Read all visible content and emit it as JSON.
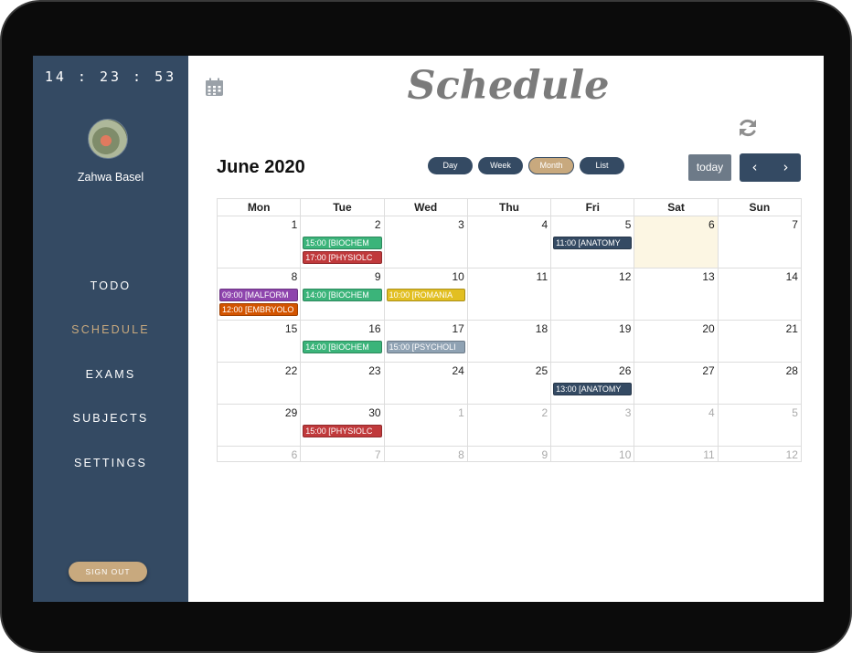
{
  "sidebar": {
    "clock": "14 : 23 : 53",
    "user_name": "Zahwa Basel",
    "nav": [
      {
        "label": "TODO",
        "active": false
      },
      {
        "label": "SCHEDULE",
        "active": true
      },
      {
        "label": "EXAMS",
        "active": false
      },
      {
        "label": "SUBJECTS",
        "active": false
      },
      {
        "label": "SETTINGS",
        "active": false
      }
    ],
    "sign_out_label": "SIGN OUT"
  },
  "header": {
    "title": "Schedule",
    "calendar_icon": "calendar-icon",
    "refresh_icon": "refresh-icon"
  },
  "toolbar": {
    "month_title": "June 2020",
    "views": [
      {
        "label": "Day",
        "active": false
      },
      {
        "label": "Week",
        "active": false
      },
      {
        "label": "Month",
        "active": true
      },
      {
        "label": "List",
        "active": false
      }
    ],
    "today_label": "today",
    "prev_label": "‹",
    "next_label": "›"
  },
  "calendar": {
    "weekdays": [
      "Mon",
      "Tue",
      "Wed",
      "Thu",
      "Fri",
      "Sat",
      "Sun"
    ],
    "weeks": [
      [
        {
          "day": "1"
        },
        {
          "day": "2",
          "events": [
            {
              "label": "15:00 [BIOCHEM",
              "color": "#3bb47a"
            },
            {
              "label": "17:00 [PHYSIOLC",
              "color": "#c0393b"
            }
          ]
        },
        {
          "day": "3"
        },
        {
          "day": "4"
        },
        {
          "day": "5",
          "events": [
            {
              "label": "11:00 [ANATOMY",
              "color": "#344a63"
            }
          ]
        },
        {
          "day": "6",
          "today": true
        },
        {
          "day": "7"
        }
      ],
      [
        {
          "day": "8",
          "events": [
            {
              "label": "09:00 [MALFORM",
              "color": "#8e44ad"
            },
            {
              "label": "12:00 [EMBRYOLO",
              "color": "#d35400"
            }
          ]
        },
        {
          "day": "9",
          "events": [
            {
              "label": "14:00 [BIOCHEM",
              "color": "#3bb47a"
            }
          ]
        },
        {
          "day": "10",
          "events": [
            {
              "label": "10:00 [ROMANIA",
              "color": "#e2bf22"
            }
          ]
        },
        {
          "day": "11"
        },
        {
          "day": "12"
        },
        {
          "day": "13"
        },
        {
          "day": "14"
        }
      ],
      [
        {
          "day": "15"
        },
        {
          "day": "16",
          "events": [
            {
              "label": "14:00 [BIOCHEM",
              "color": "#3bb47a"
            }
          ]
        },
        {
          "day": "17",
          "events": [
            {
              "label": "15:00 [PSYCHOLI",
              "color": "#8fa2b3"
            }
          ]
        },
        {
          "day": "18"
        },
        {
          "day": "19"
        },
        {
          "day": "20"
        },
        {
          "day": "21"
        }
      ],
      [
        {
          "day": "22"
        },
        {
          "day": "23"
        },
        {
          "day": "24"
        },
        {
          "day": "25"
        },
        {
          "day": "26",
          "events": [
            {
              "label": "13:00 [ANATOMY",
              "color": "#344a63"
            }
          ]
        },
        {
          "day": "27"
        },
        {
          "day": "28"
        }
      ],
      [
        {
          "day": "29"
        },
        {
          "day": "30",
          "events": [
            {
              "label": "15:00 [PHYSIOLC",
              "color": "#c0393b"
            }
          ]
        },
        {
          "day": "1",
          "other_month": true
        },
        {
          "day": "2",
          "other_month": true
        },
        {
          "day": "3",
          "other_month": true
        },
        {
          "day": "4",
          "other_month": true
        },
        {
          "day": "5",
          "other_month": true
        }
      ],
      [
        {
          "day": "6",
          "other_month": true
        },
        {
          "day": "7",
          "other_month": true
        },
        {
          "day": "8",
          "other_month": true
        },
        {
          "day": "9",
          "other_month": true
        },
        {
          "day": "10",
          "other_month": true
        },
        {
          "day": "11",
          "other_month": true
        },
        {
          "day": "12",
          "other_month": true
        }
      ]
    ]
  }
}
